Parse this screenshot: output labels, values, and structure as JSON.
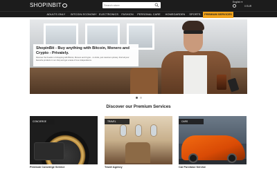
{
  "header": {
    "logo_text": "SHOPINBIT",
    "search_placeholder": "Search store",
    "language": "English ▾",
    "account_label": "",
    "cart_label": "0 EUR",
    "colors": {
      "bar": "#1c1c1c",
      "accent": "#f0a21b"
    }
  },
  "nav": {
    "items": [
      {
        "label": "ADULTS ONLY"
      },
      {
        "label": "BITCOIN ECONOMY"
      },
      {
        "label": "ELECTRONICS ▾"
      },
      {
        "label": "FASHION"
      },
      {
        "label": "PERSONAL CARE"
      },
      {
        "label": "HOMEGARDEN"
      },
      {
        "label": "SPORTS"
      },
      {
        "label": "PREMIUM SERVICES"
      }
    ]
  },
  "hero": {
    "title": "ShopinBit - Buy anything with Bitcoin, Monero and Crypto - Privately.",
    "description": "Discover the freedom of shopping with Bitcoin, Monero and Crypto - no limits, just maximum privacy. Find all your favourite products in our shop and get a taste of true independence.",
    "slides": 2,
    "active_slide": 1
  },
  "services": {
    "title": "Discover our Premium Services",
    "cards": [
      {
        "badge": "CONCIERGE",
        "label": "Premium Concierge Service"
      },
      {
        "badge": "TRAVEL",
        "label": "Travel Agency"
      },
      {
        "badge": "CARS",
        "label": "Car Purchase Service"
      }
    ]
  }
}
